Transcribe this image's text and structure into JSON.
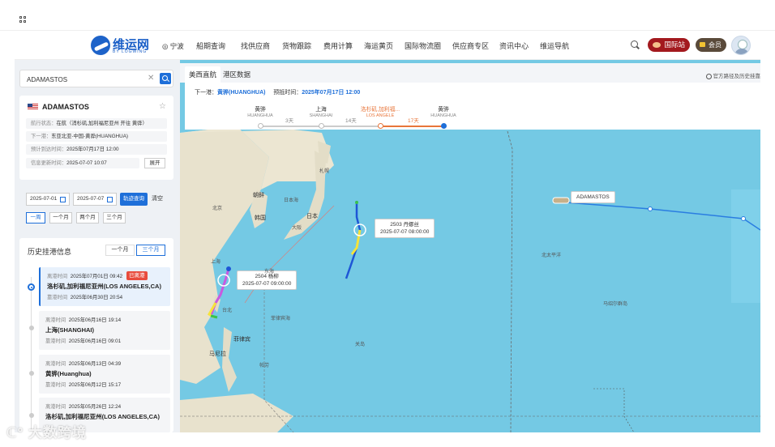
{
  "nav": {
    "logo_text": "维运网",
    "logo_sub": "BY LOGWING",
    "location": "宁波",
    "menu": [
      "船期查询",
      "找供应商",
      "货物跟踪",
      "费用计算",
      "海运黄页",
      "国际物流圈",
      "供应商专区",
      "资讯中心",
      "维运导航"
    ],
    "intl_label": "国际站",
    "member_label": "会员"
  },
  "search": {
    "value": "ADAMASTOS"
  },
  "ship": {
    "name": "ADAMASTOS",
    "rows": [
      {
        "label": "航行状态：",
        "value": "在航（消杉矶,加利福尼亚州 开往 黄骅）"
      },
      {
        "label": "下一港：",
        "value": "东亚北亚-中国-黄骅(HUANGHUA)"
      },
      {
        "label": "预计到达时间：",
        "value": "2025年07月17日 12:00"
      },
      {
        "label": "信息更新时间：",
        "value": "2025-07-07 10:07"
      }
    ],
    "expand_label": "展开"
  },
  "dates": {
    "start": "2025-07-01",
    "end": "2025-07-07",
    "track_btn": "轨迹查询",
    "clear_btn": "清空",
    "periods": [
      "一周",
      "一个月",
      "两个月",
      "三个月"
    ]
  },
  "history": {
    "title": "历史挂港信息",
    "tabs": [
      "一个月",
      "三个月"
    ],
    "items": [
      {
        "l1": "离港时间",
        "v1": "2025年07月01日 09:42",
        "badge": "已离港",
        "name": "洛杉矶,加利福尼亚州(LOS ANGELES,CA)",
        "l2": "靠港时间",
        "v2": "2025年06月30日 20:54"
      },
      {
        "l1": "离港时间",
        "v1": "2025年06月16日 19:14",
        "badge": "",
        "name": "上海(SHANGHAI)",
        "l2": "靠港时间",
        "v2": "2025年06月16日 09:01"
      },
      {
        "l1": "离港时间",
        "v1": "2025年06月13日 04:39",
        "badge": "",
        "name": "黄骅(Huanghua)",
        "l2": "靠港时间",
        "v2": "2025年06月12日 15:17"
      },
      {
        "l1": "离港时间",
        "v1": "2025年05月26日 12:24",
        "badge": "",
        "name": "洛杉矶,加利福尼亚州(LOS ANGELES,CA)",
        "l2": "",
        "v2": ""
      }
    ]
  },
  "map": {
    "tabs": [
      "美西直航",
      "港区数据"
    ],
    "hist_note": "官方路径及历史挂靠",
    "next_port_label": "下一港：",
    "next_port": "黄骅(HUANGHUA)",
    "eta_label": "预抵时间：",
    "eta": "2025年07月17日 12:00",
    "stops": [
      {
        "cn": "黄骅",
        "en": "HUANGHUA"
      },
      {
        "cn": "上海",
        "en": "SHANGHAI"
      },
      {
        "cn": "洛杉矶,加利福...",
        "en": "LOS ANGELE"
      },
      {
        "cn": "黄骅",
        "en": "HUANGHUA"
      }
    ],
    "days": [
      "3天",
      "14天",
      "17天"
    ],
    "ship_label": "ADAMASTOS",
    "typhoon1": {
      "name": "2503 丹娜丝",
      "time": "2025-07-07 08:00:00"
    },
    "typhoon2": {
      "name": "2504 杨柳",
      "time": "2025-07-07 09:00:00"
    },
    "places": [
      "朝鲜",
      "韩国",
      "日本",
      "大阪",
      "札幌",
      "北京",
      "上海",
      "台北",
      "菲律宾",
      "马尼拉",
      "日本海",
      "东海",
      "北太平洋",
      "马绍尔群岛",
      "关岛",
      "帕劳",
      "菲律宾海"
    ]
  },
  "watermark": "大数跨境",
  "colors": {
    "accent": "#1e6fd9",
    "brand": "#1a5fc7",
    "badge": "#e84c3d",
    "sea": "#74c9e4",
    "route_blue": "#2a7de1"
  }
}
